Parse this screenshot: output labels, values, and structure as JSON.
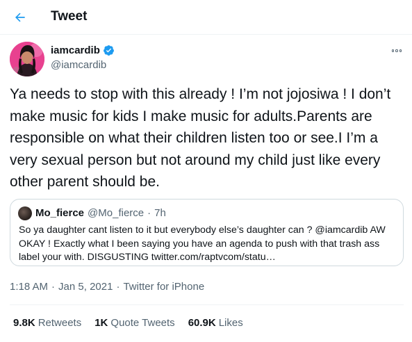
{
  "header": {
    "title": "Tweet",
    "back_icon": "arrow-left-icon"
  },
  "colors": {
    "accent": "#1d9bf0",
    "text": "#0f1419",
    "muted": "#536471",
    "border": "#cfd9de"
  },
  "tweet": {
    "author_name": "iamcardib",
    "author_handle": "@iamcardib",
    "verified": true,
    "text": "Ya needs to stop with this already ! I’m not jojosiwa ! I don’t make music for kids I make music for adults.Parents are responsible on what their children listen too or see.I I’m a very sexual person but not around my child just like every other parent should be.",
    "time": "1:18 AM",
    "date": "Jan 5, 2021",
    "source": "Twitter for iPhone",
    "sep": "·"
  },
  "quote": {
    "name": "Mo_fierce",
    "handle": "@Mo_fierce",
    "age": "7h",
    "sep": "·",
    "text": "So ya daughter cant listen to it but everybody else’s daughter can ? @iamcardib AW OKAY ! Exactly what I been saying you have an agenda to push with that trash ass label your with. DISGUSTING twitter.com/raptvcom/statu…"
  },
  "stats": [
    {
      "count": "9.8K",
      "label": "Retweets"
    },
    {
      "count": "1K",
      "label": "Quote Tweets"
    },
    {
      "count": "60.9K",
      "label": "Likes"
    }
  ]
}
